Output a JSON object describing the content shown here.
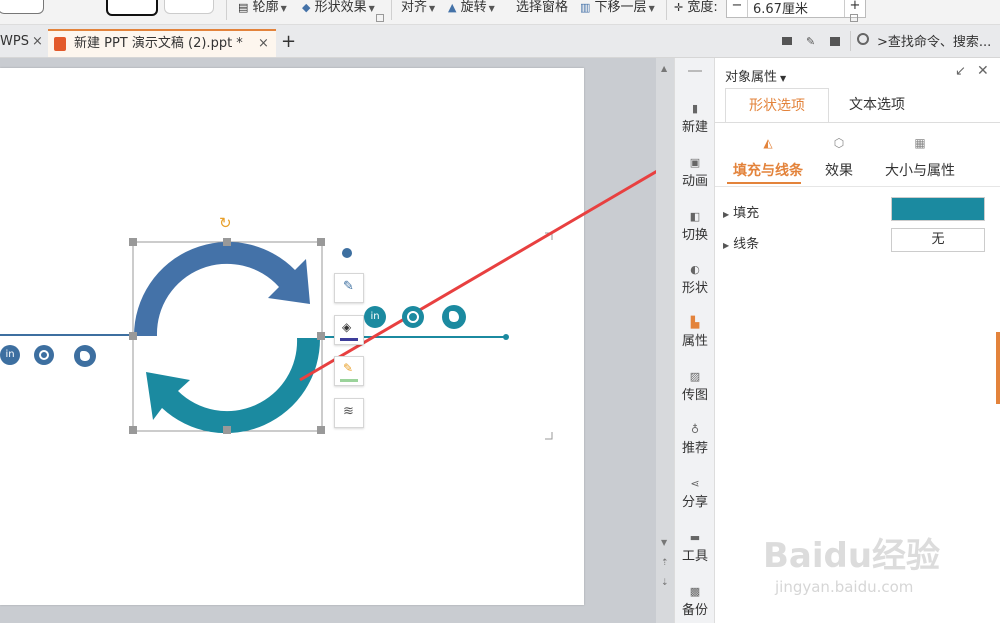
{
  "toolbar": {
    "outline_label": "轮廓",
    "shape_effect_label": "形状效果",
    "align_label": "对齐",
    "rotate_label": "旋转",
    "selection_pane_label": "选择窗格",
    "move_down_label": "下移一层",
    "width_label": "宽度:",
    "width_value": "6.67厘米",
    "minus": "−",
    "plus": "+"
  },
  "tabs": {
    "prev_tab_label": "WPS",
    "active_tab_label": "新建 PPT 演示文稿 (2).ppt *",
    "add_tab": "+",
    "close": "×",
    "search_label": ">查找命令、搜索..."
  },
  "sidenav": {
    "items": [
      {
        "label": "新建",
        "icon": "new-icon"
      },
      {
        "label": "动画",
        "icon": "animation-icon"
      },
      {
        "label": "切换",
        "icon": "transition-icon"
      },
      {
        "label": "形状",
        "icon": "shape-icon"
      },
      {
        "label": "属性",
        "icon": "property-icon"
      },
      {
        "label": "传图",
        "icon": "upload-image-icon"
      },
      {
        "label": "推荐",
        "icon": "recommend-icon"
      },
      {
        "label": "分享",
        "icon": "share-icon"
      },
      {
        "label": "工具",
        "icon": "toolbox-icon"
      },
      {
        "label": "备份",
        "icon": "backup-icon"
      }
    ]
  },
  "panel": {
    "title": "对象属性",
    "tabs": [
      "形状选项",
      "文本选项"
    ],
    "subtabs": [
      "填充与线条",
      "效果",
      "大小与属性"
    ],
    "fill_label": "填充",
    "line_label": "线条",
    "line_value": "无",
    "fill_color": "#1b8aa0"
  },
  "colors": {
    "accent": "#e3833b",
    "arrow_blue": "#4472a8",
    "arrow_teal": "#1b8aa0",
    "annotation_red": "#e84040"
  },
  "watermark": {
    "line1": "Baidu经验",
    "line2": "jingyan.baidu.com"
  }
}
